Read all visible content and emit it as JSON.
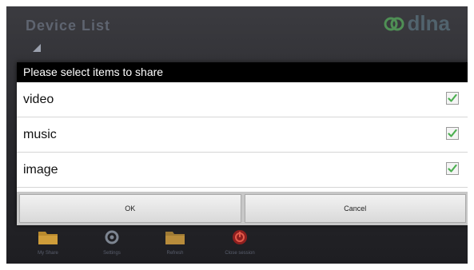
{
  "app": {
    "title": "Device List",
    "logo_text": "dlna"
  },
  "dialog": {
    "title": "Please select items to share",
    "items": [
      {
        "label": "video",
        "checked": true
      },
      {
        "label": "music",
        "checked": true
      },
      {
        "label": "image",
        "checked": true
      }
    ],
    "ok_label": "OK",
    "cancel_label": "Cancel"
  },
  "bottom_bar": {
    "items": [
      {
        "label": "My Share",
        "icon": "folder-icon"
      },
      {
        "label": "Settings",
        "icon": "settings-icon"
      },
      {
        "label": "Refresh",
        "icon": "refresh-folder-icon"
      },
      {
        "label": "Close session",
        "icon": "power-icon"
      }
    ]
  },
  "colors": {
    "check": "#4caf50",
    "accent_red": "#c0392b",
    "folder": "#b98a2e"
  }
}
